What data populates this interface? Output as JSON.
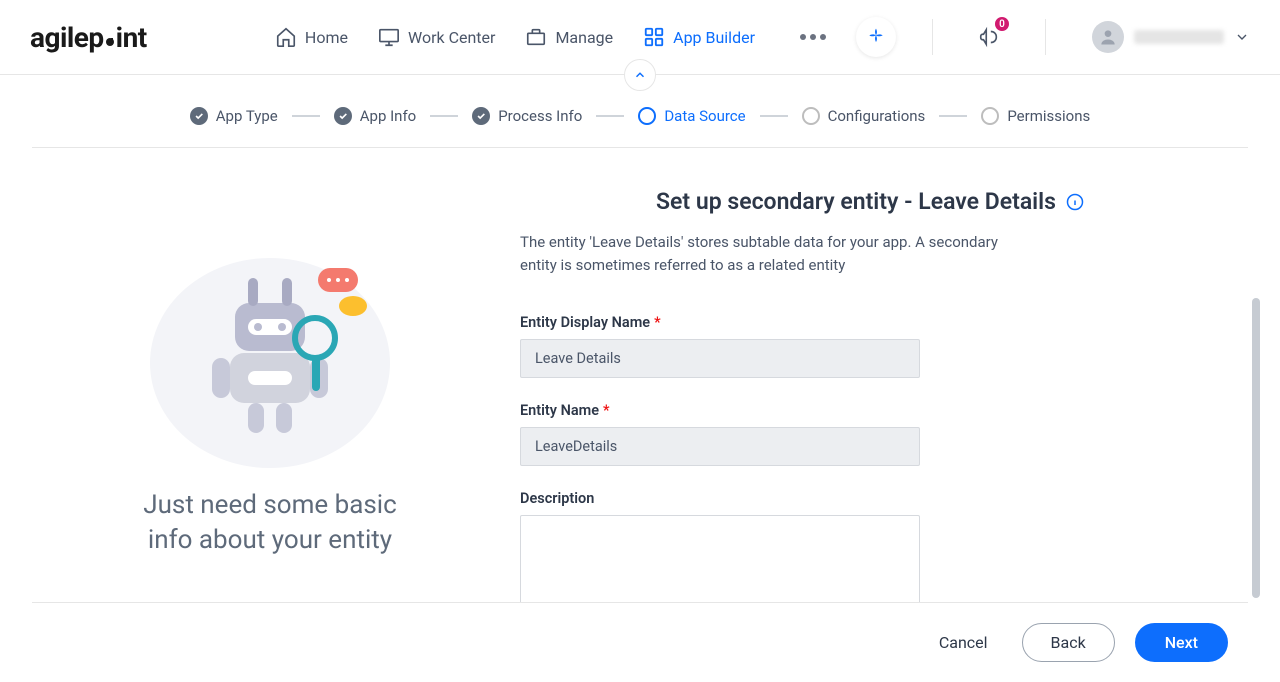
{
  "header": {
    "logo_text": "agilepoint",
    "nav": [
      {
        "label": "Home",
        "icon": "home-icon",
        "active": false
      },
      {
        "label": "Work Center",
        "icon": "monitor-icon",
        "active": false
      },
      {
        "label": "Manage",
        "icon": "briefcase-icon",
        "active": false
      },
      {
        "label": "App Builder",
        "icon": "grid-icon",
        "active": true
      }
    ],
    "notif_count": "0",
    "user_name": "(redacted)"
  },
  "stepper": {
    "steps": [
      {
        "label": "App Type",
        "state": "done"
      },
      {
        "label": "App Info",
        "state": "done"
      },
      {
        "label": "Process Info",
        "state": "done"
      },
      {
        "label": "Data Source",
        "state": "active"
      },
      {
        "label": "Configurations",
        "state": "pending"
      },
      {
        "label": "Permissions",
        "state": "pending"
      }
    ]
  },
  "main": {
    "left_text": "Just need some basic info about your entity",
    "heading": "Set up secondary entity - Leave Details",
    "subtext": "The entity 'Leave Details' stores subtable data for your app. A secondary entity is sometimes referred to as a related entity",
    "fields": {
      "display_name": {
        "label": "Entity Display Name",
        "value": "Leave Details",
        "required": true
      },
      "entity_name": {
        "label": "Entity Name",
        "value": "LeaveDetails",
        "required": true
      },
      "description": {
        "label": "Description",
        "value": "",
        "required": false
      }
    }
  },
  "footer": {
    "cancel": "Cancel",
    "back": "Back",
    "next": "Next"
  }
}
